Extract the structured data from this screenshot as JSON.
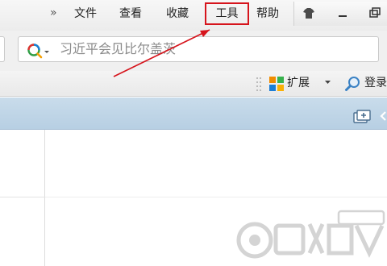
{
  "menu": {
    "more": "»",
    "file": "文件",
    "view": "查看",
    "favorites": "收藏",
    "tools": "工具",
    "help": "帮助"
  },
  "search": {
    "text": "习近平会见比尔盖茨"
  },
  "toolbar": {
    "extensions": "扩展",
    "login": "登录"
  },
  "colors": {
    "highlight_box": "#d6141c",
    "arrow": "#d6141c",
    "blue_band": "#c9dceb"
  },
  "icons": {
    "skin": "tshirt-icon",
    "minimize": "minimize-icon",
    "restore": "restore-icon",
    "search": "search-icon",
    "extensions": "extensions-grid-icon",
    "login": "login-magnifier-icon",
    "new_tab": "new-tab-icon"
  }
}
